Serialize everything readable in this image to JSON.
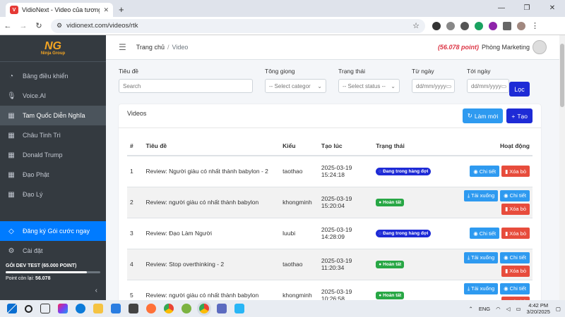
{
  "browser": {
    "tab_title": "VidioNext - Video của tương lai",
    "url": "vidionext.com/videos/rtk"
  },
  "sidebar": {
    "logo": {
      "mark": "NG",
      "name": "Ninja Group"
    },
    "items": [
      {
        "label": "Bảng điều khiển",
        "icon": "dashboard-icon"
      },
      {
        "label": "Voice.AI",
        "icon": "microphone-icon"
      },
      {
        "label": "Tam Quốc Diễn Nghĩa",
        "icon": "film-icon",
        "active": true
      },
      {
        "label": "Châu Tinh Trì",
        "icon": "film-icon"
      },
      {
        "label": "Donald Trump",
        "icon": "film-icon"
      },
      {
        "label": "Đạo Phật",
        "icon": "film-icon"
      },
      {
        "label": "Đạo Lý",
        "icon": "film-icon"
      }
    ],
    "promo": {
      "label": "Đăng ký Gói cước ngay",
      "icon": "gem-icon"
    },
    "settings": {
      "label": "Cài đặt",
      "icon": "gear-icon"
    },
    "plan": {
      "title": "GÓI DEV TEST (65.000 POINT)",
      "remaining_label": "Point còn lại:",
      "remaining_value": "56.078",
      "usage_fraction": 0.86
    }
  },
  "header": {
    "breadcrumb_home": "Trang chủ",
    "breadcrumb_current": "Video",
    "points": "(56.078 point)",
    "account": "Phòng Marketing"
  },
  "filters": {
    "title_label": "Tiêu đề",
    "title_placeholder": "Search",
    "voice_label": "Tông giọng",
    "voice_value": "-- Select categor",
    "status_label": "Trạng thái",
    "status_value": "-- Select status --",
    "from_label": "Từ ngày",
    "from_value": "dd/mm/yyyy",
    "to_label": "Tới ngày",
    "to_value": "dd/mm/yyyy",
    "filter_button": "Lọc"
  },
  "card": {
    "title": "Videos",
    "refresh_label": "Làm mới",
    "new_label": "Tạo"
  },
  "table": {
    "headers": [
      "#",
      "Tiêu đề",
      "Kiểu",
      "Tạo lúc",
      "Trạng thái",
      "Hoạt động"
    ],
    "rows": [
      {
        "id": "1",
        "title": "Review: Người giàu có nhất thành babylon - 2",
        "type": "taothao",
        "date": "2025-03-19",
        "time": "15:24:18",
        "status": "Đang trong hàng đợi",
        "status_kind": "queue"
      },
      {
        "id": "2",
        "title": "Review: người giàu có nhất thành babylon",
        "type": "khongminh",
        "date": "2025-03-19",
        "time": "15:20:04",
        "status": "Hoàn tất",
        "status_kind": "done"
      },
      {
        "id": "3",
        "title": "Review: Đạo Làm Người",
        "type": "luubi",
        "date": "2025-03-19",
        "time": "14:28:09",
        "status": "Đang trong hàng đợi",
        "status_kind": "queue"
      },
      {
        "id": "4",
        "title": "Review: Stop overthinking - 2",
        "type": "taothao",
        "date": "2025-03-19",
        "time": "11:20:34",
        "status": "Hoàn tất",
        "status_kind": "done"
      },
      {
        "id": "5",
        "title": "Review: người giàu có nhất thành babylon",
        "type": "khongminh",
        "date": "2025-03-19",
        "time": "10:26:58",
        "status": "Hoàn tất",
        "status_kind": "done"
      }
    ],
    "download_label": "Tải xuống",
    "detail_label": "Chi tiết",
    "delete_label": "Xóa bỏ"
  },
  "taskbar": {
    "lang": "ENG",
    "time": "4:42 PM",
    "date": "3/20/2025"
  }
}
